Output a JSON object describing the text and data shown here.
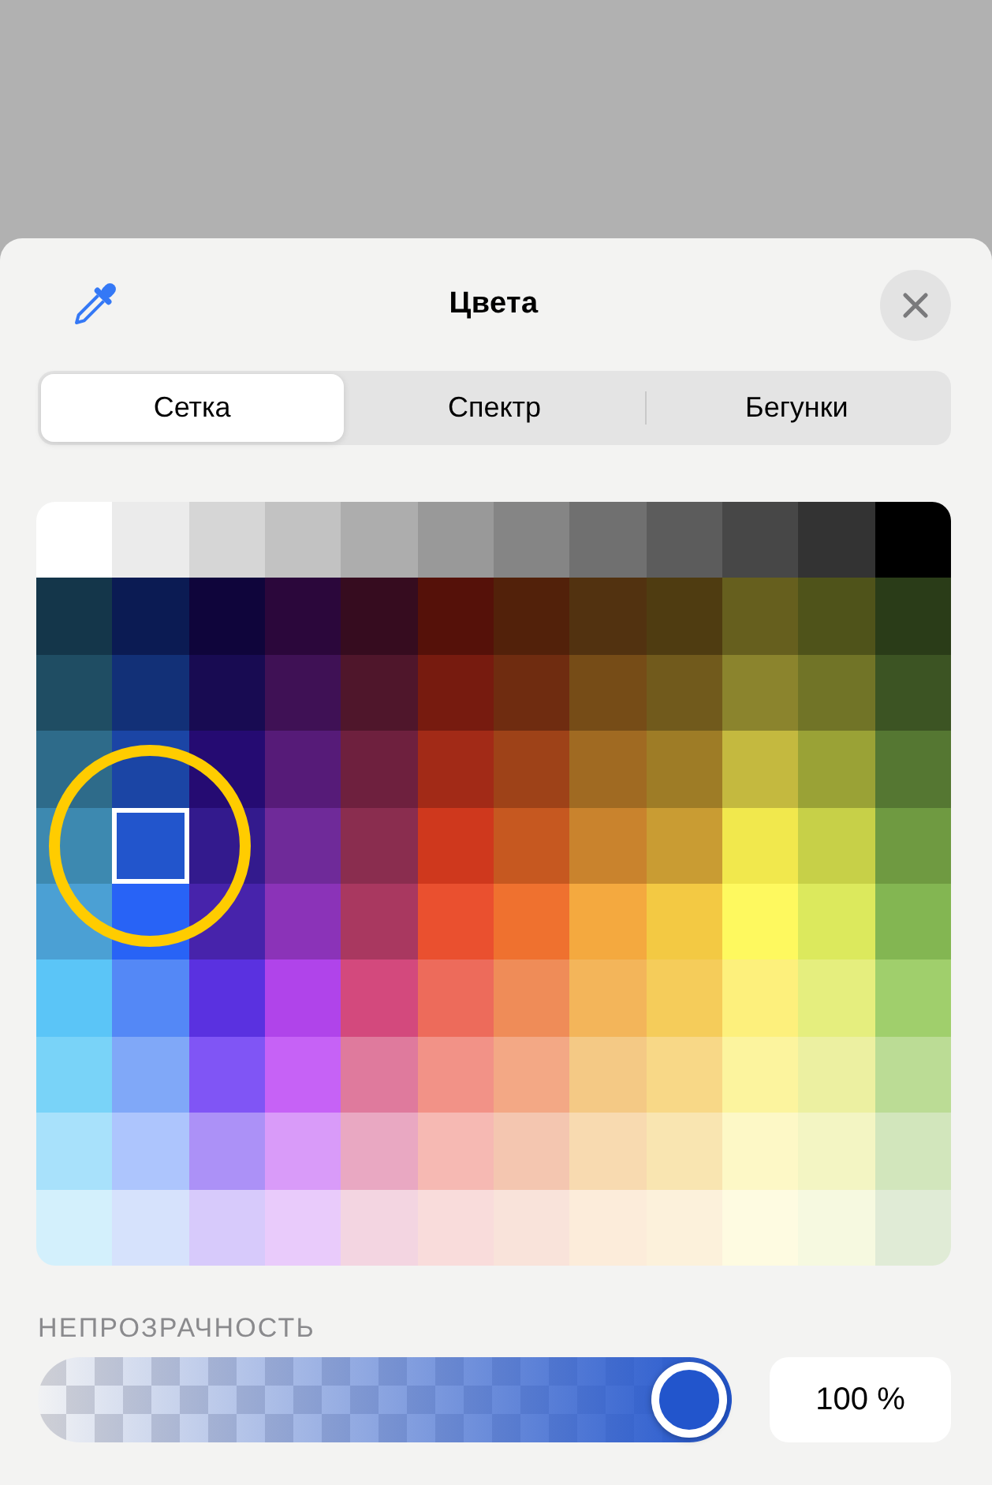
{
  "header": {
    "title": "Цвета"
  },
  "tabs": [
    {
      "label": "Сетка",
      "selected": true
    },
    {
      "label": "Спектр",
      "selected": false
    },
    {
      "label": "Бегунки",
      "selected": false
    }
  ],
  "grid": {
    "rows": [
      [
        {
          "color": "#ffffff",
          "selected": false
        },
        {
          "color": "#ebebeb",
          "selected": false
        },
        {
          "color": "#d6d6d6",
          "selected": false
        },
        {
          "color": "#c2c2c2",
          "selected": false
        },
        {
          "color": "#adadad",
          "selected": false
        },
        {
          "color": "#999999",
          "selected": false
        },
        {
          "color": "#858585",
          "selected": false
        },
        {
          "color": "#707070",
          "selected": false
        },
        {
          "color": "#5c5c5c",
          "selected": false
        },
        {
          "color": "#474747",
          "selected": false
        },
        {
          "color": "#333333",
          "selected": false
        },
        {
          "color": "#000000",
          "selected": false
        }
      ],
      [
        {
          "color": "#14364a",
          "selected": false
        },
        {
          "color": "#0b1b53",
          "selected": false
        },
        {
          "color": "#0f053b",
          "selected": false
        },
        {
          "color": "#2b073b",
          "selected": false
        },
        {
          "color": "#360c1f",
          "selected": false
        },
        {
          "color": "#551109",
          "selected": false
        },
        {
          "color": "#52210a",
          "selected": false
        },
        {
          "color": "#523210",
          "selected": false
        },
        {
          "color": "#4f3c11",
          "selected": false
        },
        {
          "color": "#665f1e",
          "selected": false
        },
        {
          "color": "#4f531a",
          "selected": false
        },
        {
          "color": "#2a3c18",
          "selected": false
        }
      ],
      [
        {
          "color": "#1f4d63",
          "selected": false
        },
        {
          "color": "#123077",
          "selected": false
        },
        {
          "color": "#180b52",
          "selected": false
        },
        {
          "color": "#3f1155",
          "selected": false
        },
        {
          "color": "#4f162b",
          "selected": false
        },
        {
          "color": "#771b0f",
          "selected": false
        },
        {
          "color": "#6f2c10",
          "selected": false
        },
        {
          "color": "#764c17",
          "selected": false
        },
        {
          "color": "#715a1c",
          "selected": false
        },
        {
          "color": "#8b842d",
          "selected": false
        },
        {
          "color": "#717427",
          "selected": false
        },
        {
          "color": "#3c5423",
          "selected": false
        }
      ],
      [
        {
          "color": "#2e6b8a",
          "selected": false
        },
        {
          "color": "#1b45a5",
          "selected": false
        },
        {
          "color": "#250b72",
          "selected": false
        },
        {
          "color": "#561b78",
          "selected": false
        },
        {
          "color": "#6e203e",
          "selected": false
        },
        {
          "color": "#a22a17",
          "selected": false
        },
        {
          "color": "#9e4218",
          "selected": false
        },
        {
          "color": "#a06a22",
          "selected": false
        },
        {
          "color": "#9e7c26",
          "selected": false
        },
        {
          "color": "#c4b93f",
          "selected": false
        },
        {
          "color": "#9aa236",
          "selected": false
        },
        {
          "color": "#557732",
          "selected": false
        }
      ],
      [
        {
          "color": "#3d89b0",
          "selected": false
        },
        {
          "color": "#2255cc",
          "selected": true
        },
        {
          "color": "#331a8d",
          "selected": false
        },
        {
          "color": "#6f2a99",
          "selected": false
        },
        {
          "color": "#8a2d4f",
          "selected": false
        },
        {
          "color": "#cf381d",
          "selected": false
        },
        {
          "color": "#c65820",
          "selected": false
        },
        {
          "color": "#c9832d",
          "selected": false
        },
        {
          "color": "#c99c33",
          "selected": false
        },
        {
          "color": "#f1e84d",
          "selected": false
        },
        {
          "color": "#c7d048",
          "selected": false
        },
        {
          "color": "#6f9a41",
          "selected": false
        }
      ],
      [
        {
          "color": "#4ba0d4",
          "selected": false
        },
        {
          "color": "#2863f6",
          "selected": false
        },
        {
          "color": "#4723ab",
          "selected": false
        },
        {
          "color": "#8b33b8",
          "selected": false
        },
        {
          "color": "#a93860",
          "selected": false
        },
        {
          "color": "#ea502f",
          "selected": false
        },
        {
          "color": "#ef712f",
          "selected": false
        },
        {
          "color": "#f4a93f",
          "selected": false
        },
        {
          "color": "#f3c943",
          "selected": false
        },
        {
          "color": "#fef95f",
          "selected": false
        },
        {
          "color": "#dce95d",
          "selected": false
        },
        {
          "color": "#83b652",
          "selected": false
        }
      ],
      [
        {
          "color": "#5bc5f7",
          "selected": false
        },
        {
          "color": "#5488f6",
          "selected": false
        },
        {
          "color": "#5a31e0",
          "selected": false
        },
        {
          "color": "#b044ea",
          "selected": false
        },
        {
          "color": "#d3497d",
          "selected": false
        },
        {
          "color": "#ed6b5b",
          "selected": false
        },
        {
          "color": "#ef8c58",
          "selected": false
        },
        {
          "color": "#f3b55a",
          "selected": false
        },
        {
          "color": "#f5cc5a",
          "selected": false
        },
        {
          "color": "#fdf07c",
          "selected": false
        },
        {
          "color": "#e5ee7e",
          "selected": false
        },
        {
          "color": "#a0cf6c",
          "selected": false
        }
      ],
      [
        {
          "color": "#79d3f8",
          "selected": false
        },
        {
          "color": "#80a8f8",
          "selected": false
        },
        {
          "color": "#8055f5",
          "selected": false
        },
        {
          "color": "#c662f6",
          "selected": false
        },
        {
          "color": "#df7a9d",
          "selected": false
        },
        {
          "color": "#f29287",
          "selected": false
        },
        {
          "color": "#f3a885",
          "selected": false
        },
        {
          "color": "#f4c985",
          "selected": false
        },
        {
          "color": "#f8d887",
          "selected": false
        },
        {
          "color": "#fcf49e",
          "selected": false
        },
        {
          "color": "#ecf0a1",
          "selected": false
        },
        {
          "color": "#bbdc95",
          "selected": false
        }
      ],
      [
        {
          "color": "#a8e1fb",
          "selected": false
        },
        {
          "color": "#adc5fd",
          "selected": false
        },
        {
          "color": "#ac91f7",
          "selected": false
        },
        {
          "color": "#d99bf9",
          "selected": false
        },
        {
          "color": "#e9a8c2",
          "selected": false
        },
        {
          "color": "#f6b9b3",
          "selected": false
        },
        {
          "color": "#f4c6b0",
          "selected": false
        },
        {
          "color": "#f8dab0",
          "selected": false
        },
        {
          "color": "#f9e5b1",
          "selected": false
        },
        {
          "color": "#fdf8c6",
          "selected": false
        },
        {
          "color": "#f3f5c3",
          "selected": false
        },
        {
          "color": "#d2e6bc",
          "selected": false
        }
      ],
      [
        {
          "color": "#d3f0fc",
          "selected": false
        },
        {
          "color": "#d6e2fc",
          "selected": false
        },
        {
          "color": "#d7cafb",
          "selected": false
        },
        {
          "color": "#e9cbfb",
          "selected": false
        },
        {
          "color": "#f3d5e1",
          "selected": false
        },
        {
          "color": "#f9dcdb",
          "selected": false
        },
        {
          "color": "#f9e3da",
          "selected": false
        },
        {
          "color": "#fcecda",
          "selected": false
        },
        {
          "color": "#fcf1db",
          "selected": false
        },
        {
          "color": "#fefbe1",
          "selected": false
        },
        {
          "color": "#f6f9e0",
          "selected": false
        },
        {
          "color": "#e0ebd6",
          "selected": false
        }
      ]
    ]
  },
  "opacity": {
    "label": "НЕПРОЗРАЧНОСТЬ",
    "level": 1,
    "value": "100 %"
  }
}
